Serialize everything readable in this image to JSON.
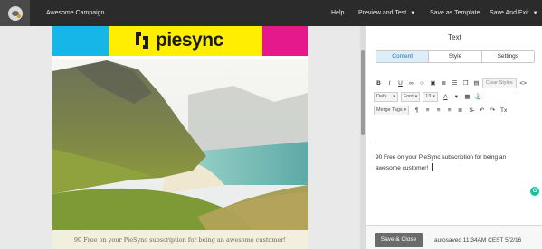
{
  "topbar": {
    "campaign_title": "Awesome Campaign",
    "help": "Help",
    "preview_and_test": "Preview and Test",
    "save_as_template": "Save as Template",
    "save_and_exit": "Save And Exit"
  },
  "email": {
    "brand": "piesync",
    "footer_text": "90 Free on your PieSync subscription for being an awesome customer!",
    "colors": {
      "cyan": "#16b7e8",
      "yellow": "#ffee00",
      "magenta": "#e6198a"
    }
  },
  "panel": {
    "title": "Text",
    "tabs": [
      "Content",
      "Style",
      "Settings"
    ],
    "active_tab": "Content",
    "toolbar": {
      "clear_styles": "Clear Styles",
      "font_select": "Defa...",
      "format_select": "Font",
      "size_select": "13",
      "merge_tags": "Merge Tags",
      "icons": [
        "bold-icon",
        "italic-icon",
        "underline-icon",
        "link-icon",
        "unlink-icon",
        "image-icon",
        "ordered-list-icon",
        "unordered-list-icon",
        "copy-icon",
        "paste-icon",
        "source-code-icon",
        "text-color-icon",
        "background-color-icon",
        "table-icon",
        "anchor-icon",
        "paragraph-icon",
        "align-left-icon",
        "align-center-icon",
        "align-right-icon",
        "justify-icon",
        "strikethrough-icon",
        "undo-icon",
        "redo-icon",
        "remove-format-icon"
      ]
    },
    "editor_text": "90 Free on your PieSync subscription for being an awesome customer!",
    "save_close": "Save & Close",
    "autosave": "autosaved 11:34AM CEST 5/2/16"
  }
}
